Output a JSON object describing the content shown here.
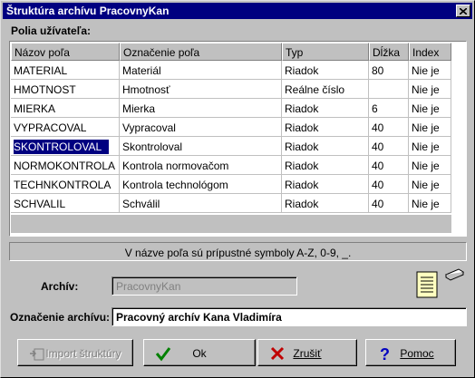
{
  "window": {
    "title": "Štruktúra archívu PracovnyKan"
  },
  "fields_label": "Polia užívateľa:",
  "table": {
    "columns": [
      "Názov poľa",
      "Označenie poľa",
      "Typ",
      "Dĺžka",
      "Index"
    ],
    "rows": [
      [
        "MATERIAL",
        "Materiál",
        "Riadok",
        "80",
        "Nie je"
      ],
      [
        "HMOTNOST",
        "Hmotnosť",
        "Reálne číslo",
        "",
        "Nie je"
      ],
      [
        "MIERKA",
        "Mierka",
        "Riadok",
        "6",
        "Nie je"
      ],
      [
        "VYPRACOVAL",
        "Vypracoval",
        "Riadok",
        "40",
        "Nie je"
      ],
      [
        "SKONTROLOVAL",
        "Skontroloval",
        "Riadok",
        "40",
        "Nie je"
      ],
      [
        "NORMOKONTROLA",
        "Kontrola normovačom",
        "Riadok",
        "40",
        "Nie je"
      ],
      [
        "TECHNKONTROLA",
        "Kontrola technológom",
        "Riadok",
        "40",
        "Nie je"
      ],
      [
        "SCHVALIL",
        "Schválil",
        "Riadok",
        "40",
        "Nie je"
      ]
    ],
    "selected_row": 4
  },
  "hint": "V názve poľa sú prípustné symboly A-Z, 0-9, _.",
  "archive": {
    "label": "Archív:",
    "value": "PracovnyKan"
  },
  "archive_desc": {
    "label": "Označenie archívu:",
    "value": "Pracovný archív Kana Vladimíra"
  },
  "buttons": {
    "import": "Import štruktúry",
    "ok": "Ok",
    "cancel": "Zrušiť",
    "help": "Pomoc"
  },
  "icons": {
    "close": "close-icon",
    "notes": "notepad-icon",
    "ok": "checkmark-icon",
    "cancel": "x-icon",
    "help": "question-icon",
    "import": "import-icon"
  }
}
